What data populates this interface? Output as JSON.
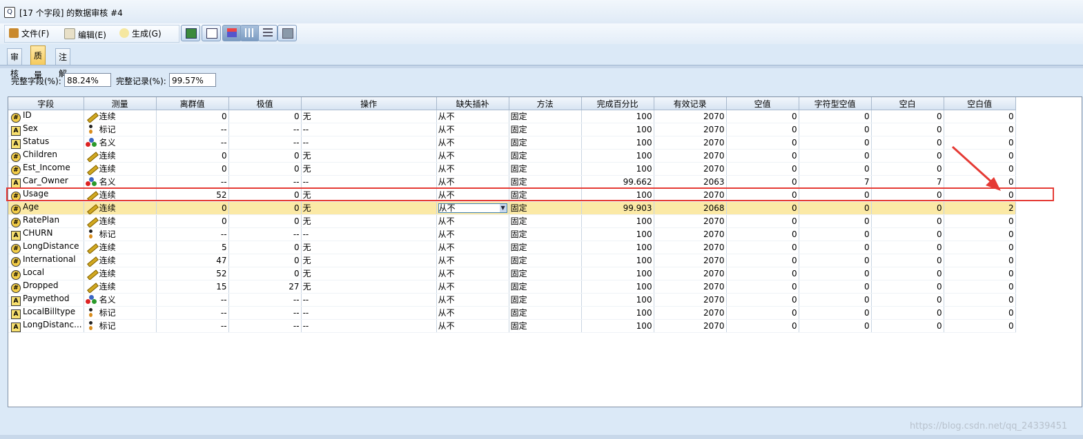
{
  "window": {
    "title": "[17 个字段] 的数据审核 #4"
  },
  "menu": {
    "file": "文件(F)",
    "edit": "编辑(E)",
    "generate": "生成(G)"
  },
  "tabs": [
    "审核",
    "质量",
    "注解"
  ],
  "summary": {
    "complete_fields_label": "完整字段(%):",
    "complete_fields_value": "88.24%",
    "complete_records_label": "完整记录(%):",
    "complete_records_value": "99.57%"
  },
  "columns": [
    "字段",
    "测量",
    "离群值",
    "极值",
    "操作",
    "缺失插补",
    "方法",
    "完成百分比",
    "有效记录",
    "空值",
    "字符型空值",
    "空白",
    "空白值"
  ],
  "rows": [
    {
      "field": "ID",
      "type": "num",
      "measure": "连续",
      "mi": "ruler",
      "outlier": "0",
      "extreme": "0",
      "action": "无",
      "impute": "从不",
      "method": "固定",
      "pct": "100",
      "valid": "2070",
      "null": "0",
      "strnull": "0",
      "blank": "0",
      "blankval": "0"
    },
    {
      "field": "Sex",
      "type": "str",
      "measure": "标记",
      "mi": "flag",
      "outlier": "--",
      "extreme": "--",
      "action": "--",
      "impute": "从不",
      "method": "固定",
      "pct": "100",
      "valid": "2070",
      "null": "0",
      "strnull": "0",
      "blank": "0",
      "blankval": "0"
    },
    {
      "field": "Status",
      "type": "str",
      "measure": "名义",
      "mi": "nominal",
      "outlier": "--",
      "extreme": "--",
      "action": "--",
      "impute": "从不",
      "method": "固定",
      "pct": "100",
      "valid": "2070",
      "null": "0",
      "strnull": "0",
      "blank": "0",
      "blankval": "0"
    },
    {
      "field": "Children",
      "type": "num",
      "measure": "连续",
      "mi": "ruler",
      "outlier": "0",
      "extreme": "0",
      "action": "无",
      "impute": "从不",
      "method": "固定",
      "pct": "100",
      "valid": "2070",
      "null": "0",
      "strnull": "0",
      "blank": "0",
      "blankval": "0"
    },
    {
      "field": "Est_Income",
      "type": "num",
      "measure": "连续",
      "mi": "ruler",
      "outlier": "0",
      "extreme": "0",
      "action": "无",
      "impute": "从不",
      "method": "固定",
      "pct": "100",
      "valid": "2070",
      "null": "0",
      "strnull": "0",
      "blank": "0",
      "blankval": "0"
    },
    {
      "field": "Car_Owner",
      "type": "str",
      "measure": "名义",
      "mi": "nominal",
      "outlier": "--",
      "extreme": "--",
      "action": "--",
      "impute": "从不",
      "method": "固定",
      "pct": "99.662",
      "valid": "2063",
      "null": "0",
      "strnull": "7",
      "blank": "7",
      "blankval": "0"
    },
    {
      "field": "Usage",
      "type": "num",
      "measure": "连续",
      "mi": "ruler",
      "outlier": "52",
      "extreme": "0",
      "action": "无",
      "impute": "从不",
      "method": "固定",
      "pct": "100",
      "valid": "2070",
      "null": "0",
      "strnull": "0",
      "blank": "0",
      "blankval": "0"
    },
    {
      "field": "Age",
      "type": "num",
      "measure": "连续",
      "mi": "ruler",
      "outlier": "0",
      "extreme": "0",
      "action": "无",
      "impute": "从不",
      "method": "固定",
      "pct": "99.903",
      "valid": "2068",
      "null": "0",
      "strnull": "0",
      "blank": "0",
      "blankval": "2",
      "selected": true
    },
    {
      "field": "RatePlan",
      "type": "num",
      "measure": "连续",
      "mi": "ruler",
      "outlier": "0",
      "extreme": "0",
      "action": "无",
      "impute": "从不",
      "method": "固定",
      "pct": "100",
      "valid": "2070",
      "null": "0",
      "strnull": "0",
      "blank": "0",
      "blankval": "0"
    },
    {
      "field": "CHURN",
      "type": "str",
      "measure": "标记",
      "mi": "flag",
      "outlier": "--",
      "extreme": "--",
      "action": "--",
      "impute": "从不",
      "method": "固定",
      "pct": "100",
      "valid": "2070",
      "null": "0",
      "strnull": "0",
      "blank": "0",
      "blankval": "0"
    },
    {
      "field": "LongDistance",
      "type": "num",
      "measure": "连续",
      "mi": "ruler",
      "outlier": "5",
      "extreme": "0",
      "action": "无",
      "impute": "从不",
      "method": "固定",
      "pct": "100",
      "valid": "2070",
      "null": "0",
      "strnull": "0",
      "blank": "0",
      "blankval": "0"
    },
    {
      "field": "International",
      "type": "num",
      "measure": "连续",
      "mi": "ruler",
      "outlier": "47",
      "extreme": "0",
      "action": "无",
      "impute": "从不",
      "method": "固定",
      "pct": "100",
      "valid": "2070",
      "null": "0",
      "strnull": "0",
      "blank": "0",
      "blankval": "0"
    },
    {
      "field": "Local",
      "type": "num",
      "measure": "连续",
      "mi": "ruler",
      "outlier": "52",
      "extreme": "0",
      "action": "无",
      "impute": "从不",
      "method": "固定",
      "pct": "100",
      "valid": "2070",
      "null": "0",
      "strnull": "0",
      "blank": "0",
      "blankval": "0"
    },
    {
      "field": "Dropped",
      "type": "num",
      "measure": "连续",
      "mi": "ruler",
      "outlier": "15",
      "extreme": "27",
      "action": "无",
      "impute": "从不",
      "method": "固定",
      "pct": "100",
      "valid": "2070",
      "null": "0",
      "strnull": "0",
      "blank": "0",
      "blankval": "0"
    },
    {
      "field": "Paymethod",
      "type": "str",
      "measure": "名义",
      "mi": "nominal",
      "outlier": "--",
      "extreme": "--",
      "action": "--",
      "impute": "从不",
      "method": "固定",
      "pct": "100",
      "valid": "2070",
      "null": "0",
      "strnull": "0",
      "blank": "0",
      "blankval": "0"
    },
    {
      "field": "LocalBilltype",
      "type": "str",
      "measure": "标记",
      "mi": "flag",
      "outlier": "--",
      "extreme": "--",
      "action": "--",
      "impute": "从不",
      "method": "固定",
      "pct": "100",
      "valid": "2070",
      "null": "0",
      "strnull": "0",
      "blank": "0",
      "blankval": "0"
    },
    {
      "field": "LongDistanc...",
      "type": "str",
      "measure": "标记",
      "mi": "flag",
      "outlier": "--",
      "extreme": "--",
      "action": "--",
      "impute": "从不",
      "method": "固定",
      "pct": "100",
      "valid": "2070",
      "null": "0",
      "strnull": "0",
      "blank": "0",
      "blankval": "0"
    }
  ],
  "annotation_color": "#e53a34",
  "watermark": "https://blog.csdn.net/qq_24339451"
}
